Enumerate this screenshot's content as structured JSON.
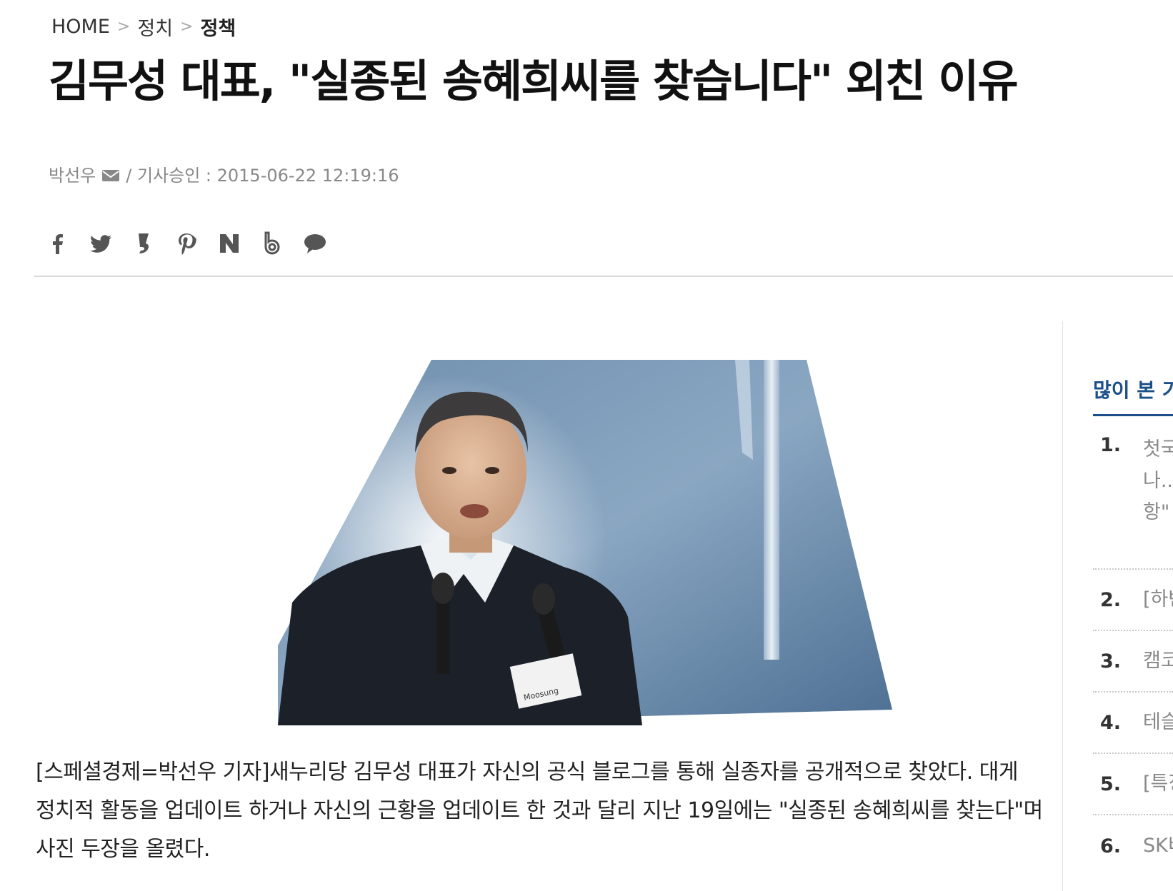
{
  "breadcrumb": {
    "home": "HOME",
    "sep1": ">",
    "level1": "정치",
    "sep2": ">",
    "level2": "정책"
  },
  "article": {
    "title": "김무성 대표, \"실종된 송혜희씨를 찾습니다\" 외친 이유",
    "author": "박선우",
    "approval": "/ 기사승인 : 2015-06-22 12:19:16",
    "body": "[스페셜경제=박선우 기자]새누리당 김무성 대표가 자신의 공식 블로그를 통해 실종자를 공개적으로 찾았다. 대게 정치적 활동을 업데이트 하거나 자신의 근황을 업데이트 한 것과 달리 지난 19일에는 \"실종된 송혜희씨를 찾는다\"며 사진 두장을 올렸다."
  },
  "share_icons": [
    "facebook-icon",
    "twitter-icon",
    "kakaostory-icon",
    "pinterest-icon",
    "naver-icon",
    "band-icon",
    "kakaotalk-icon"
  ],
  "photo": {
    "badge_text": "Moosung"
  },
  "sidebar": {
    "title": "많이 본 기",
    "items": [
      {
        "num": "1.",
        "lines": [
          "첫국",
          "나..",
          "항\""
        ]
      },
      {
        "num": "2.",
        "lines": [
          "[하반"
        ]
      },
      {
        "num": "3.",
        "lines": [
          "캠코"
        ]
      },
      {
        "num": "4.",
        "lines": [
          "테슬"
        ]
      },
      {
        "num": "5.",
        "lines": [
          "[특징"
        ]
      },
      {
        "num": "6.",
        "lines": [
          "SK비"
        ]
      }
    ]
  },
  "colors": {
    "accent": "#1a4f8a",
    "icon_gray": "#555555",
    "meta_gray": "#888888"
  }
}
